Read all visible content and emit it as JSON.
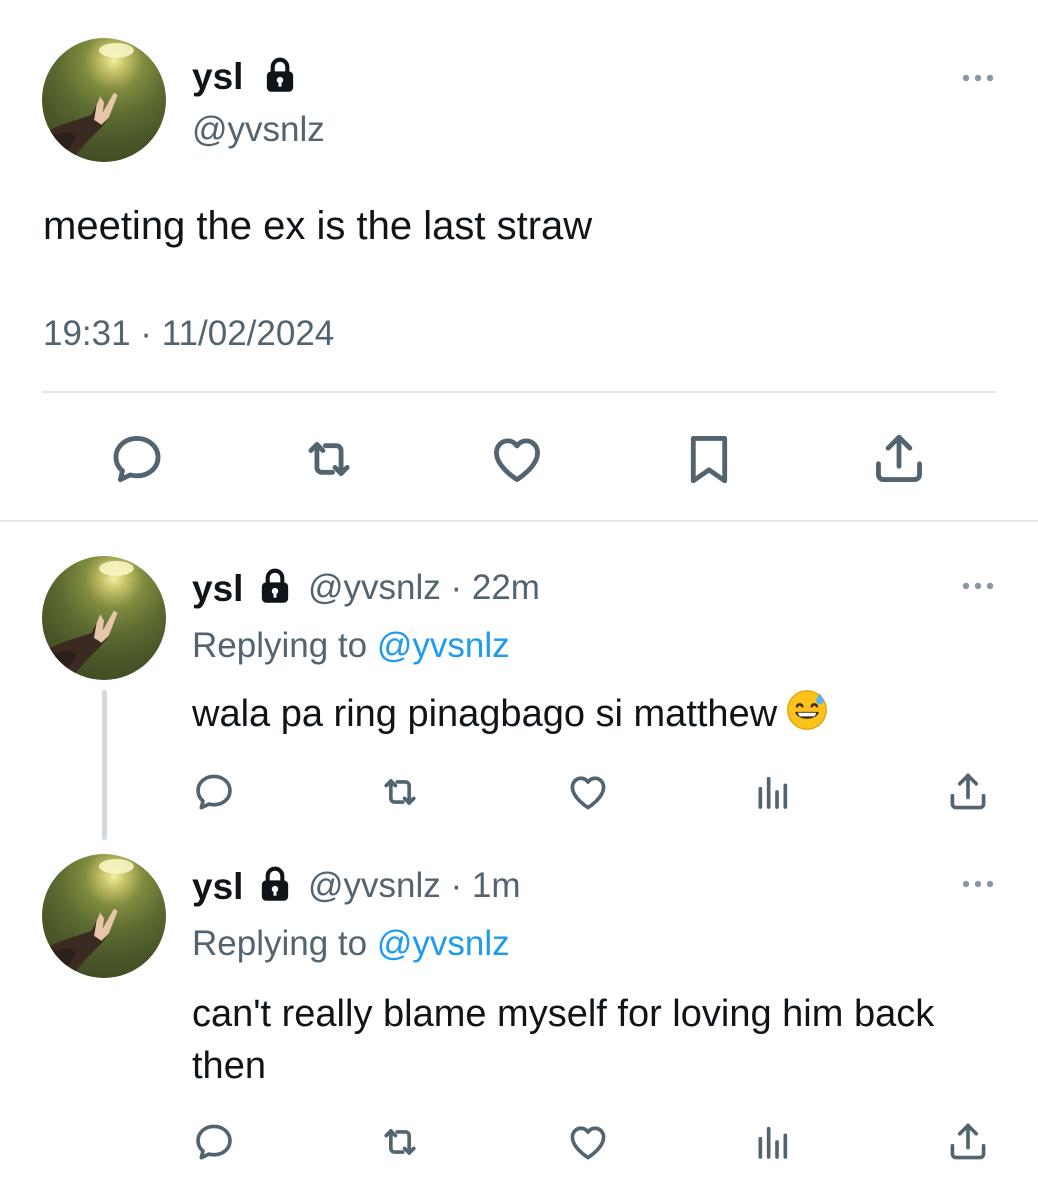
{
  "main_tweet": {
    "display_name": "ysl",
    "handle": "@yvsnlz",
    "text": "meeting the ex is the last straw",
    "timestamp": "19:31 · 11/02/2024"
  },
  "replies": [
    {
      "display_name": "ysl",
      "handle_time": "@yvsnlz · 22m",
      "replying_prefix": "Replying to",
      "replying_mention": "@yvsnlz",
      "text": "wala pa ring pinagbago si matthew",
      "emoji": "grinning-face-with-sweat-icon"
    },
    {
      "display_name": "ysl",
      "handle_time": "@yvsnlz · 1m",
      "replying_prefix": "Replying to",
      "replying_mention": "@yvsnlz",
      "text": "can't really blame myself for loving him back then"
    }
  ],
  "icons": {
    "main_actions": [
      "reply-icon",
      "retweet-icon",
      "like-icon",
      "bookmark-icon",
      "share-icon"
    ],
    "reply_actions": [
      "reply-icon",
      "retweet-icon",
      "like-icon",
      "views-icon",
      "share-icon"
    ]
  },
  "colors": {
    "text": "#0f1419",
    "secondary": "#536471",
    "accent": "#1d9bf0",
    "divider": "#e1e6ea"
  }
}
